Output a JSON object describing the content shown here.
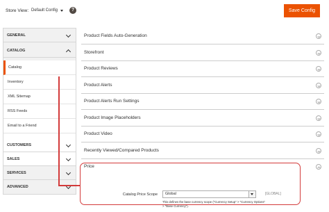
{
  "topbar": {
    "store_view_label": "Store View:",
    "scope_value": "Default Config",
    "help_icon": "?",
    "save_label": "Save Config"
  },
  "sidebar": {
    "general": "GENERAL",
    "catalog": "CATALOG",
    "catalog_items": [
      "Catalog",
      "Inventory",
      "XML Sitemap",
      "RSS Feeds",
      "Email to a Friend"
    ],
    "customers": "CUSTOMERS",
    "sales": "SALES",
    "services": "SERVICES",
    "advanced": "ADVANCED"
  },
  "sections": [
    "Product Fields Auto-Generation",
    "Storefront",
    "Product Reviews",
    "Product Alerts",
    "Product Alerts Run Settings",
    "Product Image Placeholders",
    "Product Video",
    "Recently Viewed/Compared Products",
    "Price"
  ],
  "price": {
    "label": "Catalog Price Scope",
    "value": "Global",
    "scope_tag": "[GLOBAL]",
    "note": "This defines the base currency scope (\"Currency Setup\" > \"Currency Options\" > \"Base Currency\")."
  },
  "colors": {
    "accent": "#eb5202",
    "annotation": "#d33a3a"
  }
}
